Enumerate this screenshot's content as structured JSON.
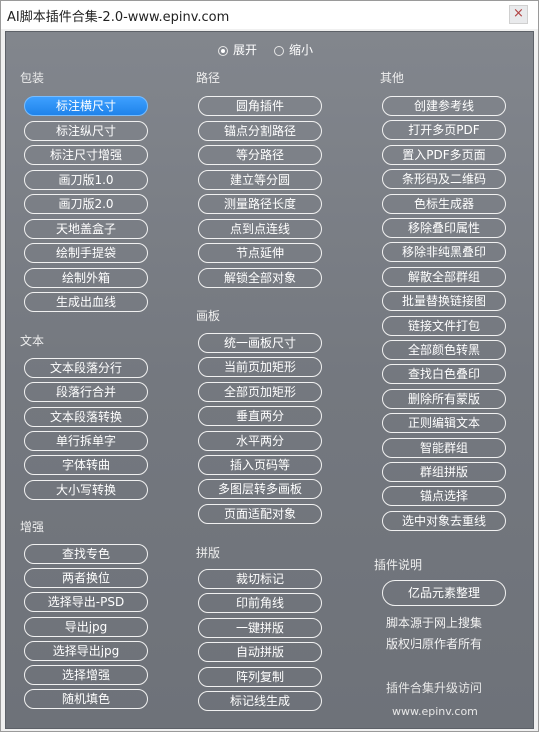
{
  "window": {
    "title": "AI脚本插件合集-2.0-www.epinv.com",
    "close_glyph": "×"
  },
  "toggle": {
    "expand": "展开",
    "collapse": "缩小",
    "selected": "expand"
  },
  "columns": {
    "packaging": {
      "header": "包装",
      "items": [
        "标注横尺寸",
        "标注纵尺寸",
        "标注尺寸增强",
        "画刀版1.0",
        "画刀版2.0",
        "天地盖盒子",
        "绘制手提袋",
        "绘制外箱",
        "生成出血线"
      ],
      "active_index": 0
    },
    "text": {
      "header": "文本",
      "items": [
        "文本段落分行",
        "段落行合并",
        "文本段落转换",
        "单行拆单字",
        "字体转曲",
        "大小写转换"
      ]
    },
    "enhance": {
      "header": "增强",
      "items": [
        "查找专色",
        "两者换位",
        "选择导出-PSD",
        "导出jpg",
        "选择导出jpg",
        "选择增强",
        "随机填色"
      ]
    },
    "path": {
      "header": "路径",
      "items": [
        "圆角插件",
        "锚点分割路径",
        "等分路径",
        "建立等分圆",
        "测量路径长度",
        "点到点连线",
        "节点延伸",
        "解锁全部对象"
      ]
    },
    "artboard": {
      "header": "画板",
      "items": [
        "统一画板尺寸",
        "当前页加矩形",
        "全部页加矩形",
        "垂直两分",
        "水平两分",
        "插入页码等",
        "多图层转多画板",
        "页面适配对象"
      ]
    },
    "imposition": {
      "header": "拼版",
      "items": [
        "裁切标记",
        "印前角线",
        "一键拼版",
        "自动拼版",
        "阵列复制",
        "标记线生成"
      ]
    },
    "other": {
      "header": "其他",
      "items": [
        "创建参考线",
        "打开多页PDF",
        "置入PDF多页面",
        "条形码及二维码",
        "色标生成器",
        "移除叠印属性",
        "移除非纯黑叠印",
        "解散全部群组",
        "批量替换链接图",
        "链接文件打包",
        "全部颜色转黑",
        "查找白色叠印",
        "删除所有蒙版",
        "正则编辑文本",
        "智能群组",
        "群组拼版",
        "锚点选择",
        "选中对象去重线"
      ]
    },
    "info": {
      "header": "插件说明",
      "button": "亿品元素整理",
      "lines": [
        "脚本源于网上搜集",
        "版权归原作者所有"
      ],
      "upgrade": "插件合集升级访问",
      "url": "www.epinv.com"
    }
  },
  "colors": {
    "panel": "#7b7f86",
    "active": "#1f83ea",
    "text": "#ffffff"
  }
}
